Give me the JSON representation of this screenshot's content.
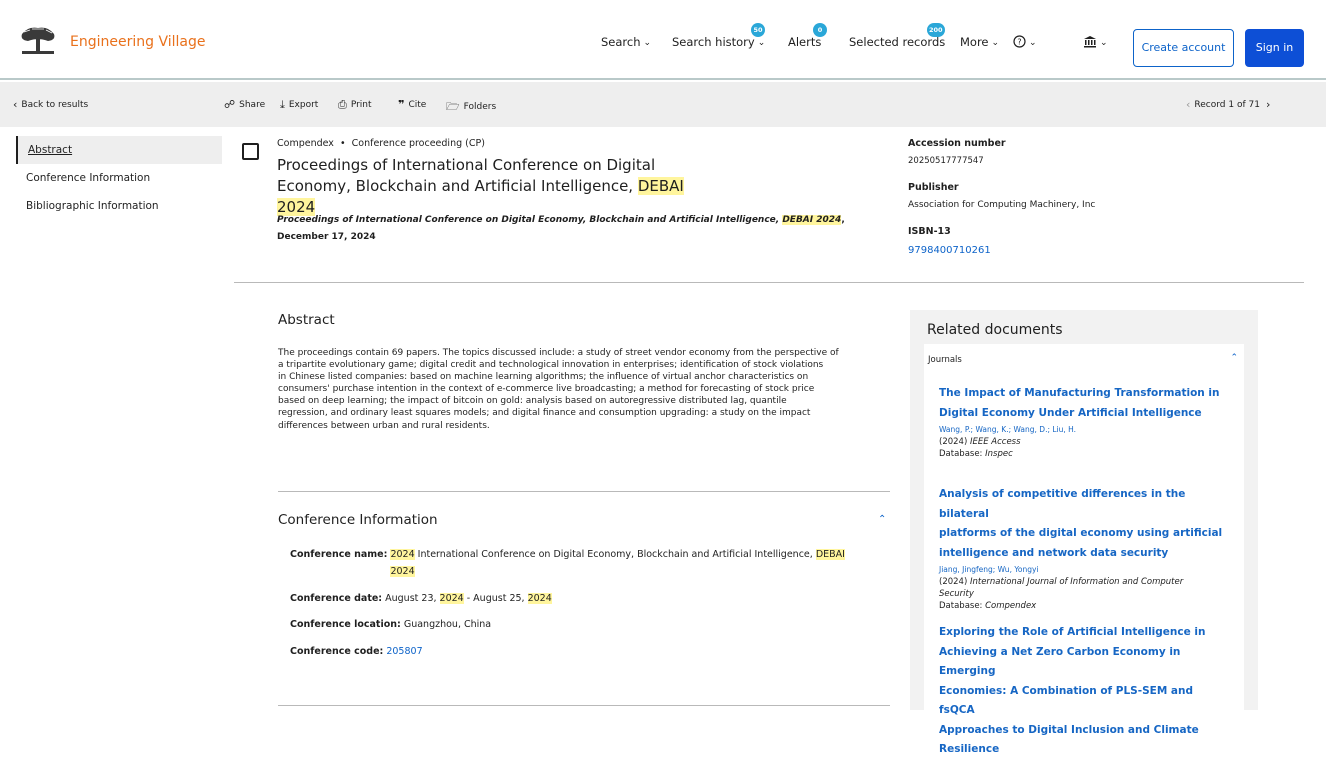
{
  "header": {
    "brand": "Engineering Village",
    "nav": {
      "search": "Search",
      "search_history": "Search history",
      "search_history_badge": "50",
      "alerts": "Alerts",
      "alerts_badge": "0",
      "selected_records": "Selected records",
      "selected_records_badge": "200",
      "more": "More"
    },
    "create_account": "Create account",
    "sign_in": "Sign in"
  },
  "toolbar": {
    "back": "Back to results",
    "share": "Share",
    "export": "Export",
    "print": "Print",
    "cite": "Cite",
    "folders": "Folders",
    "record": "Record 1 of 71"
  },
  "sidenav": {
    "items": [
      "Abstract",
      "Conference Information",
      "Bibliographic Information"
    ]
  },
  "record": {
    "database": "Compendex",
    "doc_type": "Conference proceeding (CP)",
    "title_1": "Proceedings of International Conference on Digital",
    "title_2": "Economy, Blockchain and Artificial Intelligence, ",
    "title_hl1": "DEBAI",
    "title_hl2": "2024",
    "source_text": "Proceedings of International Conference on Digital Economy, Blockchain and Artificial Intelligence, ",
    "source_hl": "DEBAI 2024",
    "source_date": ", December 17, 2024"
  },
  "details": {
    "accession_label": "Accession number",
    "accession_value": "20250517777547",
    "publisher_label": "Publisher",
    "publisher_value": "Association for Computing Machinery, Inc",
    "isbn_label": "ISBN-13",
    "isbn_value": "9798400710261"
  },
  "abstract": {
    "heading": "Abstract",
    "lines": [
      "The proceedings contain 69 papers. The topics discussed include: a study of street vendor economy from the perspective of",
      "a tripartite evolutionary game; digital credit and technological innovation in enterprises; identification of stock violations",
      "in Chinese listed companies: based on machine learning algorithms; the influence of virtual anchor characteristics on",
      "consumers' purchase intention in the context of e-commerce live broadcasting; a method for forecasting of stock price",
      "based on deep learning; the impact of bitcoin on gold: analysis based on autoregressive distributed lag, quantile",
      "regression, and ordinary least squares models; and digital finance and consumption upgrading: a study on the impact",
      "differences between urban and rural residents."
    ]
  },
  "conference": {
    "heading": "Conference Information",
    "name_label": "Conference name:",
    "name_hl1": "2024",
    "name_text": " International Conference on Digital Economy, Blockchain and Artificial Intelligence, ",
    "name_hl2": "DEBAI",
    "name_hl3": "2024",
    "date_label": "Conference date:",
    "date_text1": " August 23, ",
    "date_hl1": "2024",
    "date_text2": " - August 25, ",
    "date_hl2": "2024",
    "location_label": "Conference location:",
    "location_value": " Guangzhou, China",
    "code_label": "Conference code:",
    "code_value": "205807"
  },
  "related": {
    "heading": "Related documents",
    "group": "Journals",
    "docs": [
      {
        "title1": "The Impact of Manufacturing Transformation in",
        "title2": "Digital Economy Under Artificial Intelligence",
        "authors": "Wang, P.;  Wang, K.;  Wang, D.;    Liu, H.",
        "year": "(2024)",
        "journal": "IEEE Access",
        "db_label": "Database:",
        "db": "Inspec"
      },
      {
        "title1": "Analysis of competitive differences in the bilateral",
        "title2": "platforms of the digital economy using artificial",
        "title3": "intelligence and network data security",
        "authors": "Jiang, Jingfeng; Wu, Yongyi",
        "year": "(2024)",
        "journal1": "International Journal of Information and Computer",
        "journal2": "Security",
        "db_label": "Database:",
        "db": "Compendex"
      },
      {
        "title1": "Exploring the Role of Artificial Intelligence in",
        "title2": "Achieving a Net Zero Carbon Economy in Emerging",
        "title3": "Economies: A Combination of PLS-SEM and fsQCA",
        "title4": "Approaches to Digital Inclusion and Climate",
        "title5": "Resilience"
      }
    ]
  },
  "icons": [
    "library-tree-logo",
    "help-icon",
    "institution-icon",
    "share-icon",
    "export-icon",
    "print-icon",
    "cite-icon",
    "folders-icon",
    "chevron-left-icon",
    "chevron-right-icon",
    "chevron-up-icon",
    "checkbox"
  ],
  "colors": {
    "brand": "#e9711c",
    "link": "#0d63c9",
    "primary_button": "#0d4fd6",
    "highlight": "#fff59d",
    "badge": "#2aa7d8"
  }
}
